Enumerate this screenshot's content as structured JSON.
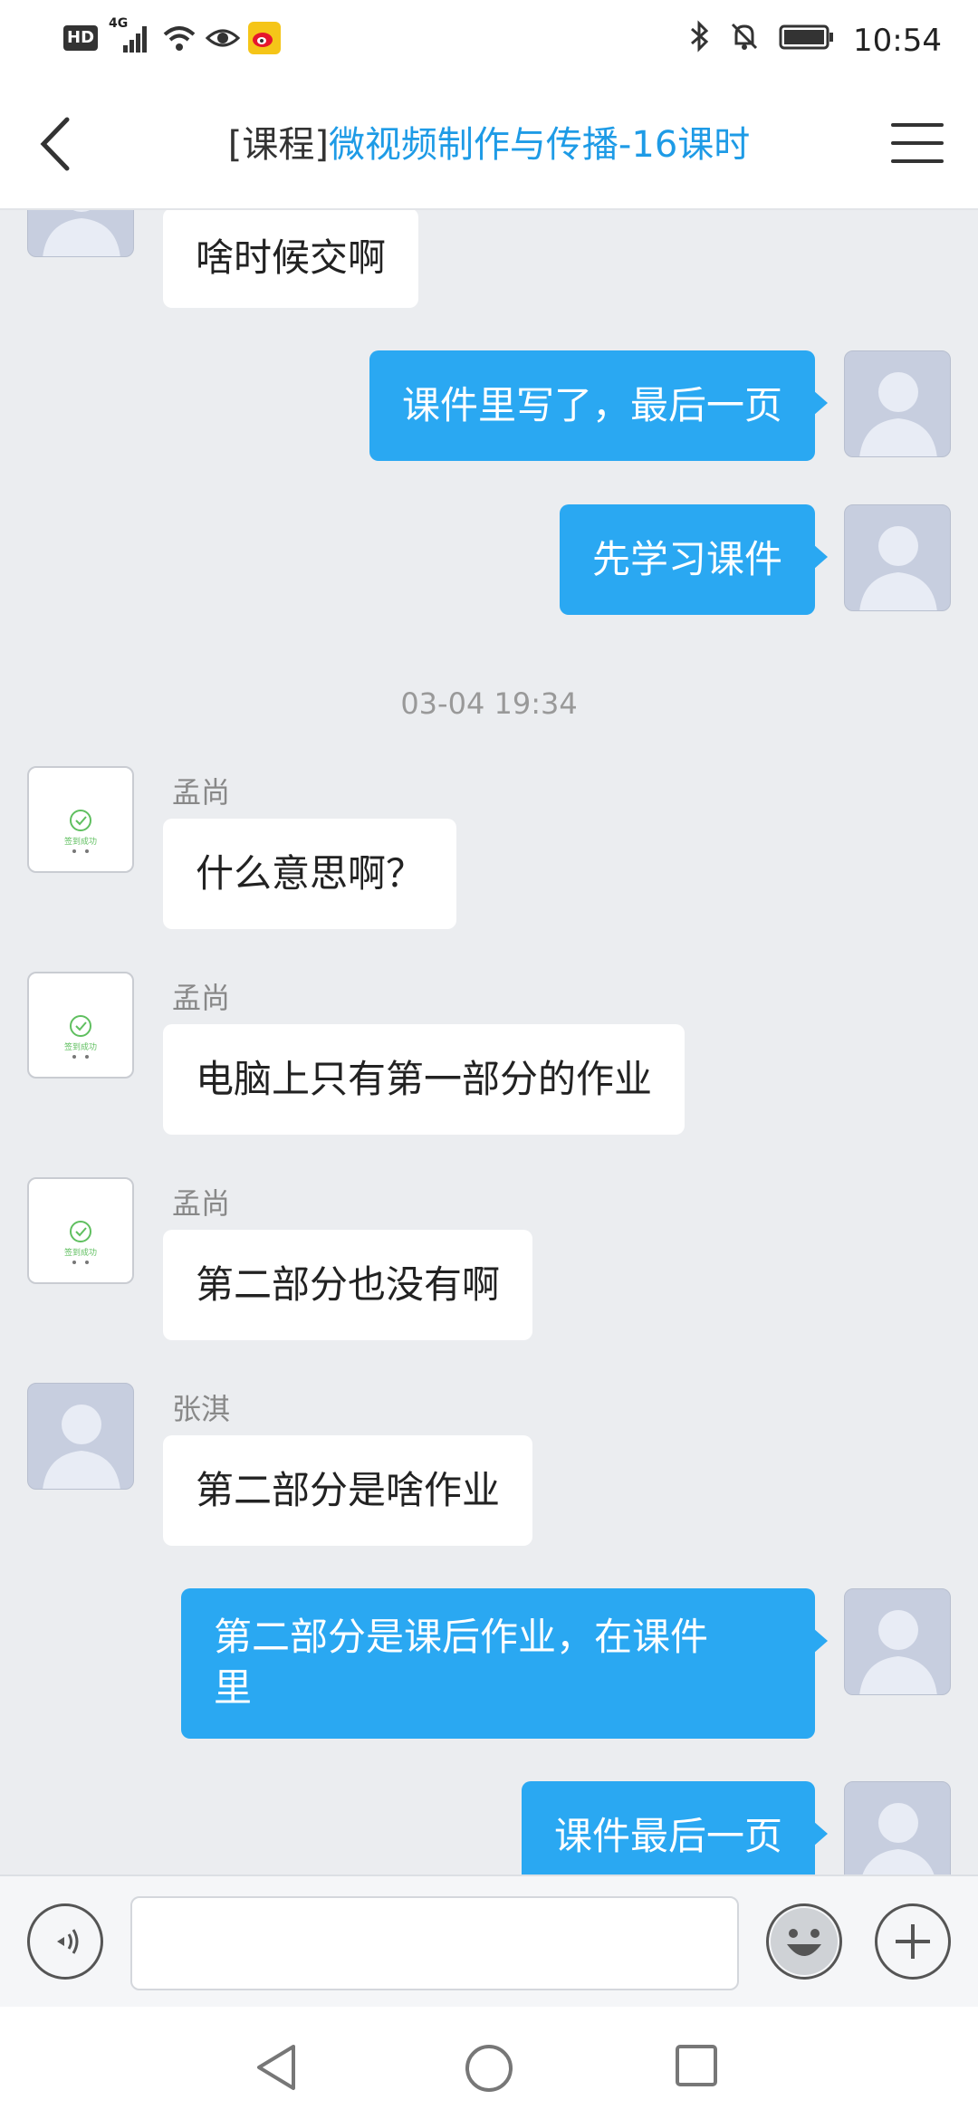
{
  "status_bar": {
    "network": "4G",
    "hd_label": "HD",
    "time": "10:54",
    "icons": [
      "hd-icon",
      "signal-icon",
      "wifi-icon",
      "eye-icon",
      "weibo-icon",
      "bluetooth-icon",
      "bell-off-icon",
      "battery-icon"
    ]
  },
  "header": {
    "tag": "[课程]",
    "title": "微视频制作与传播-16课时",
    "back_icon": "chevron-left-icon",
    "menu_icon": "menu-icon"
  },
  "messages": [
    {
      "direction": "in",
      "sender": "",
      "text": "啥时候交啊",
      "avatar": "default"
    },
    {
      "direction": "out",
      "text": "课件里写了，最后一页"
    },
    {
      "direction": "out",
      "text": "先学习课件"
    },
    {
      "timestamp": "03-04 19:34"
    },
    {
      "direction": "in",
      "sender": "孟尚",
      "text": "什么意思啊？",
      "avatar": "sign-success"
    },
    {
      "direction": "in",
      "sender": "孟尚",
      "text": "电脑上只有第一部分的作业",
      "avatar": "sign-success"
    },
    {
      "direction": "in",
      "sender": "孟尚",
      "text": "第二部分也没有啊",
      "avatar": "sign-success"
    },
    {
      "direction": "in",
      "sender": "张淇",
      "text": "第二部分是啥作业",
      "avatar": "default"
    },
    {
      "direction": "out",
      "text_line1": "第二部分是课后作业，在课件",
      "text_line2": "里"
    },
    {
      "direction": "out",
      "text": "课件最后一页"
    }
  ],
  "sign_avatar_text": "签到成功",
  "input_bar": {
    "voice_icon": "voice-icon",
    "input_value": "",
    "emoji_icon": "emoji-icon",
    "add_icon": "plus-icon"
  },
  "nav_bar": {
    "icons": [
      "nav-back-icon",
      "nav-home-icon",
      "nav-recents-icon"
    ]
  },
  "colors": {
    "accent": "#1e9be6",
    "outgoing_bubble": "#2aa8f2",
    "chat_background": "#ebedf0"
  }
}
